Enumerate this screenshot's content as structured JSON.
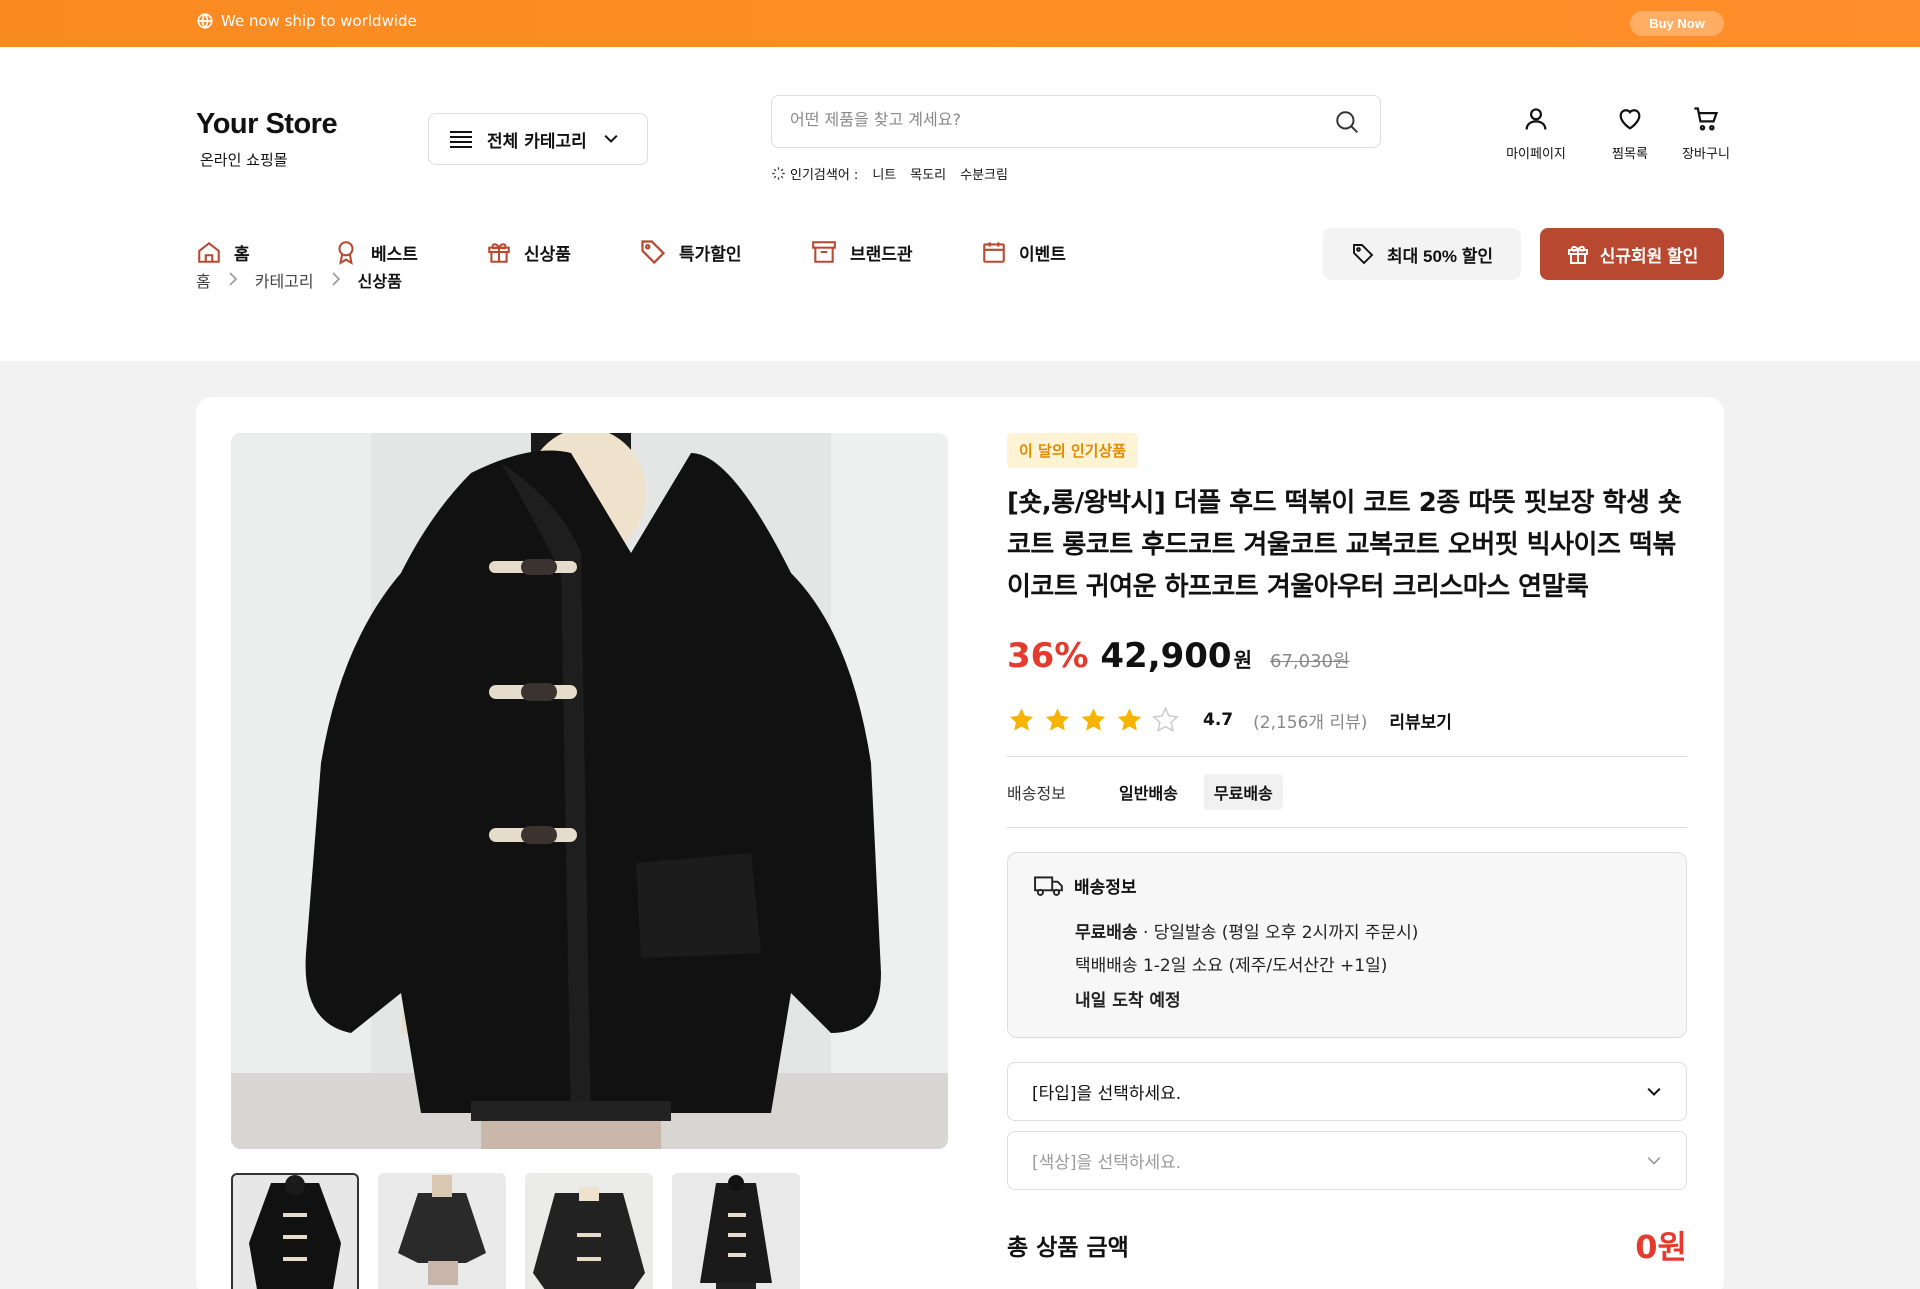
{
  "topbar": {
    "shipping_text": "We now ship to worldwide",
    "buy_now": "Buy Now",
    "color": "#fe8f26"
  },
  "header": {
    "logo_name": "Your Store",
    "logo_sub": "온라인 쇼핑몰",
    "category_button": "전체 카테고리",
    "search_placeholder": "어떤 제품을 찾고 계세요?",
    "popular_label": "인기검색어 :",
    "popular_keywords": [
      "니트",
      "목도리",
      "수분크림"
    ],
    "user_icons": [
      {
        "label": "마이페이지",
        "icon": "user-icon"
      },
      {
        "label": "찜목록",
        "icon": "heart-icon"
      },
      {
        "label": "장바구니",
        "icon": "cart-icon"
      }
    ]
  },
  "nav": {
    "items": [
      {
        "label": "홈",
        "icon": "home-icon"
      },
      {
        "label": "베스트",
        "icon": "award-icon"
      },
      {
        "label": "신상품",
        "icon": "gift-icon"
      },
      {
        "label": "특가할인",
        "icon": "tag-icon"
      },
      {
        "label": "브랜드관",
        "icon": "archive-icon"
      },
      {
        "label": "이벤트",
        "icon": "calendar-icon"
      }
    ],
    "promo_discount": "최대 50% 할인",
    "promo_member": "신규회원 할인",
    "accent_color": "#b8482f"
  },
  "breadcrumb": [
    "홈",
    "카테고리",
    "신상품"
  ],
  "product": {
    "badge": "이 달의 인기상품",
    "title": "[숏,롱/왕박시] 더플 후드 떡볶이 코트 2종 따뜻 핏보장 학생 숏코트 롱코트 후드코트 겨울코트 교복코트 오버핏 빅사이즈 떡볶이코트 귀여운 하프코트 겨울아우터 크리스마스 연말룩",
    "discount": "36%",
    "price": "42,900",
    "price_unit": "원",
    "original_price": "67,030원",
    "rating": "4.7",
    "stars_filled": 4,
    "stars_total": 5,
    "review_count": "(2,156개 리뷰)",
    "review_link": "리뷰보기",
    "shipping_label": "배송정보",
    "shipping_options": [
      "일반배송",
      "무료배송"
    ],
    "shipping_box": {
      "title": "배송정보",
      "line1_bold": "무료배송",
      "line1_rest": " · 당일발송 (평일 오후 2시까지 주문시)",
      "line2": "택배배송 1-2일 소요 (제주/도서산간 +1일)",
      "line3": "내일 도착 예정"
    },
    "select_type": "[타입]을 선택하세요.",
    "select_color": "[색상]을 선택하세요.",
    "total_label": "총 상품 금액",
    "total_value": "0원",
    "sale_color": "#e53a2e",
    "badge_color": "#fff3d6"
  }
}
